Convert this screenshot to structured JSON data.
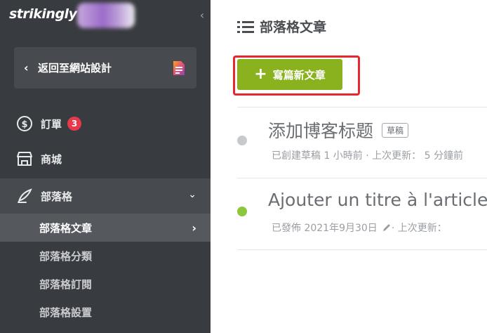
{
  "sidebar": {
    "logo": "strikingly",
    "back_label": "返回至網站設計",
    "items": [
      {
        "label": "訂單",
        "badge": "3"
      },
      {
        "label": "商城"
      },
      {
        "label": "部落格"
      }
    ],
    "blog_sub": [
      {
        "label": "部落格文章"
      },
      {
        "label": "部落格分類"
      },
      {
        "label": "部落格訂閱"
      },
      {
        "label": "部落格設置"
      }
    ]
  },
  "main": {
    "title": "部落格文章",
    "new_post_label": "寫篇新文章",
    "posts": [
      {
        "title": "添加博客标题",
        "tag": "草稿",
        "meta": "已創建草稿 1 小時前 · 上次更新： 5 分鐘前",
        "status_color": "#c7cacd"
      },
      {
        "title": "Ajouter un titre à l'article de blog",
        "meta_date": "已發佈 2021年9月30日",
        "meta_rest": " · 上次更新：",
        "status_color": "#8dc63f"
      }
    ]
  },
  "colors": {
    "sidebar_bg": "#383b3f",
    "accent_green": "#8ab21e",
    "highlight_red": "#e8262e",
    "badge_red": "#e8394b"
  }
}
